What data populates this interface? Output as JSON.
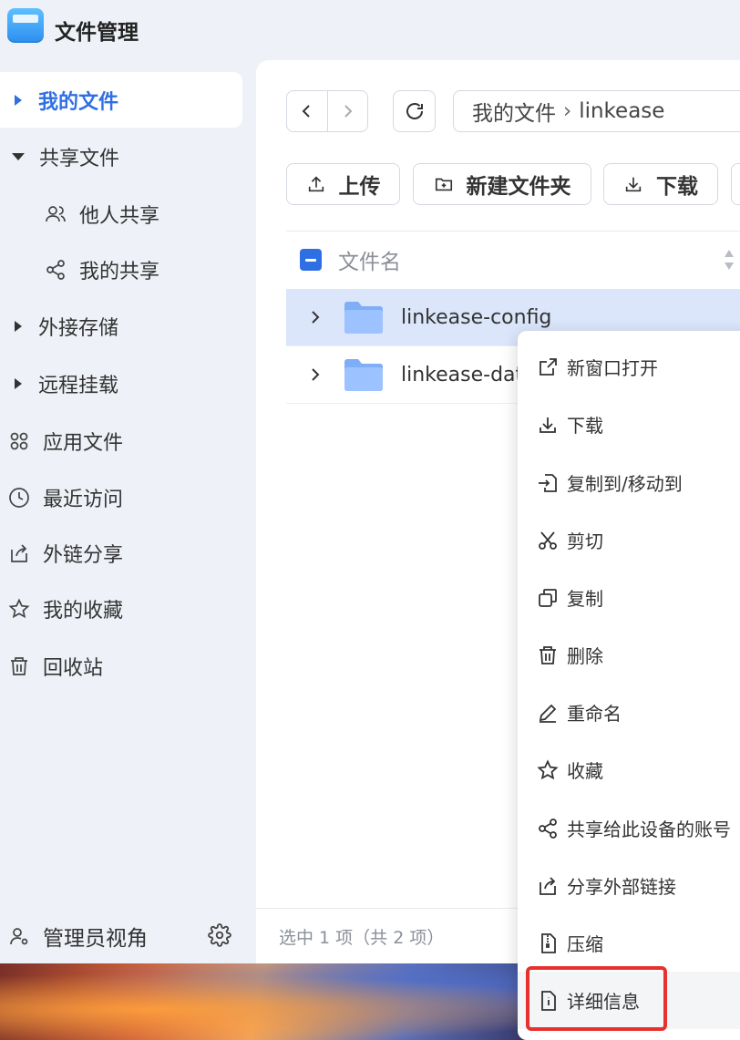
{
  "app": {
    "title": "文件管理"
  },
  "sidebar": {
    "items": [
      {
        "label": "我的文件",
        "icon": "caret-right-icon"
      },
      {
        "label": "共享文件",
        "icon": "caret-down-icon"
      },
      {
        "label": "他人共享",
        "icon": "users-icon"
      },
      {
        "label": "我的共享",
        "icon": "share-icon"
      },
      {
        "label": "外接存储",
        "icon": "caret-right-icon"
      },
      {
        "label": "远程挂载",
        "icon": "caret-right-icon"
      },
      {
        "label": "应用文件",
        "icon": "apps-icon"
      },
      {
        "label": "最近访问",
        "icon": "clock-icon"
      },
      {
        "label": "外链分享",
        "icon": "external-share-icon"
      },
      {
        "label": "我的收藏",
        "icon": "star-icon"
      },
      {
        "label": "回收站",
        "icon": "trash-icon"
      }
    ],
    "footer": {
      "label": "管理员视角"
    }
  },
  "toolbar": {
    "path_root": "我的文件",
    "path_current": "linkease",
    "upload_label": "上传",
    "new_folder_label": "新建文件夹",
    "download_label": "下载"
  },
  "table": {
    "column_name": "文件名",
    "rows": [
      {
        "name": "linkease-config",
        "selected": true
      },
      {
        "name": "linkease-data",
        "selected": false
      }
    ]
  },
  "status": {
    "text": "选中 1 项（共 2 项）"
  },
  "context_menu": {
    "items": [
      {
        "label": "新窗口打开"
      },
      {
        "label": "下载"
      },
      {
        "label": "复制到/移动到"
      },
      {
        "label": "剪切"
      },
      {
        "label": "复制"
      },
      {
        "label": "删除"
      },
      {
        "label": "重命名"
      },
      {
        "label": "收藏"
      },
      {
        "label": "共享给此设备的账号"
      },
      {
        "label": "分享外部链接"
      },
      {
        "label": "压缩"
      },
      {
        "label": "详细信息"
      }
    ]
  },
  "colors": {
    "accent": "#2f6fe4",
    "selected_row": "#dbe6fb",
    "highlight_border": "#e8312f"
  }
}
